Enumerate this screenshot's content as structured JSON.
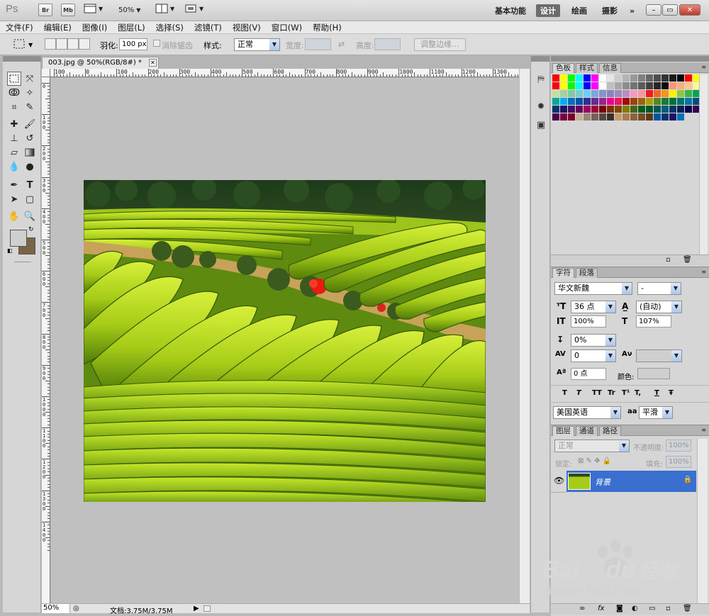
{
  "app": {
    "logo_text": "Ps"
  },
  "titlebar": {
    "bridge_label": "Br",
    "minibridge_label": "Mb",
    "zoom_label": "50%",
    "workspaces": [
      "基本功能",
      "设计",
      "绘画",
      "摄影"
    ],
    "active_workspace": "设计",
    "more_label": "»"
  },
  "menubar": {
    "items": [
      "文件(F)",
      "编辑(E)",
      "图像(I)",
      "图层(L)",
      "选择(S)",
      "滤镜(T)",
      "视图(V)",
      "窗口(W)",
      "帮助(H)"
    ]
  },
  "options": {
    "feather_label": "羽化:",
    "feather_value": "100 px",
    "antialias_label": "消除锯齿",
    "style_label": "样式:",
    "style_value": "正常",
    "width_label": "宽度:",
    "height_label": "高度:",
    "refine_edge_label": "调整边缘..."
  },
  "document": {
    "tab_title": "003.jpg @ 50%(RGB/8#) *",
    "hruler_labels": [
      "100",
      "0",
      "100",
      "200",
      "300",
      "400",
      "500",
      "600",
      "700",
      "800",
      "900",
      "1000",
      "1100",
      "1200",
      "1300"
    ],
    "vruler_labels": [
      "0",
      "100",
      "200",
      "300",
      "400",
      "500",
      "600",
      "700",
      "800",
      "900",
      "1000",
      "1100",
      "1200",
      "1300",
      "1400"
    ],
    "status_zoom": "50%",
    "status_doc": "文档:3.75M/3.75M"
  },
  "swatches_panel": {
    "tabs": [
      "色板",
      "样式",
      "信息"
    ],
    "active_tab": "色板"
  },
  "character_panel": {
    "tabs": [
      "字符",
      "段落"
    ],
    "active_tab": "字符",
    "font_family": "华文新魏",
    "font_style": "-",
    "font_size": "36 点",
    "leading": "(自动)",
    "vertical_scale": "100%",
    "horizontal_scale": "107%",
    "kerning": "0%",
    "tracking": "0",
    "baseline_shift": "0 点",
    "color_label": "颜色:",
    "format_buttons": [
      "T",
      "T",
      "TT",
      "Tr",
      "T¹",
      "T,",
      "T",
      "Ŧ"
    ],
    "language": "美国英语",
    "antialias_label": "aa",
    "antialias_value": "平滑"
  },
  "layers_panel": {
    "tabs": [
      "图层",
      "通道",
      "路径"
    ],
    "active_tab": "图层",
    "blend_mode": "正常",
    "opacity_label": "不透明度:",
    "opacity_value": "100%",
    "lock_label": "锁定:",
    "fill_label": "填充:",
    "fill_value": "100%",
    "layers": [
      {
        "name": "背景",
        "visible": true,
        "locked": true
      }
    ]
  },
  "watermark": {
    "brand": "Bai",
    "brand2": "du",
    "cn": "经验",
    "url": "jingyan.baidu.com"
  },
  "colors": {
    "foreground": "#cfcfcf",
    "background": "#7a6446",
    "selected_layer": "#3a6fd0",
    "active_workspace_bg": "#6c6c6c"
  }
}
